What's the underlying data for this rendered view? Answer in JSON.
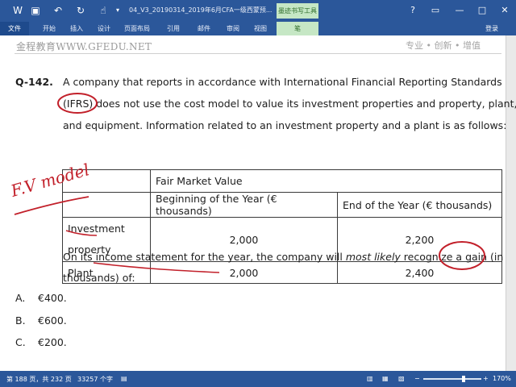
{
  "window": {
    "title": "04_V3_20190314_2019年6月CFA一级西蒙预...",
    "tool_tab": "墨迹书写工具",
    "login": "登录",
    "min_glyph": "—",
    "max_glyph": "□",
    "close_glyph": "✕",
    "help_glyph": "?"
  },
  "ribbon": {
    "tabs": [
      {
        "label": "文件"
      },
      {
        "label": "开始"
      },
      {
        "label": "插入"
      },
      {
        "label": "设计"
      },
      {
        "label": "页面布局"
      },
      {
        "label": "引用"
      },
      {
        "label": "邮件"
      },
      {
        "label": "审阅"
      },
      {
        "label": "视图"
      },
      {
        "label": "笔"
      }
    ]
  },
  "document": {
    "header_left": "金程教育WWW.GFEDU.NET",
    "header_right": "专业 • 创新 • 增值",
    "question_number": "Q-142.",
    "lines": [
      "A company that reports in accordance with International Financial Reporting Standards",
      "(IFRS) does not use the cost model to value its investment properties and property, plant,",
      "and equipment. Information related to an investment property and a plant is as follows:"
    ],
    "table": {
      "group_header": "Fair Market Value",
      "col_headers": [
        "Beginning of the Year (€ thousands)",
        "End of the Year (€ thousands)"
      ],
      "rows": [
        {
          "label_line1": "Investment",
          "label_line2": "property",
          "begin": "2,000",
          "end": "2,200"
        },
        {
          "label_line1": "Plant",
          "begin": "2,000",
          "end": "2,400"
        }
      ]
    },
    "prompt_line1_a": "On its income statement for the year, the company will ",
    "prompt_line1_em": "most likely",
    "prompt_line1_b": " recognize a gain (in",
    "prompt_line2": "thousands) of:",
    "options": [
      {
        "letter": "A.",
        "text": "€400."
      },
      {
        "letter": "B.",
        "text": "€600."
      },
      {
        "letter": "C.",
        "text": "€200."
      }
    ],
    "ink_note": "F.V model"
  },
  "status": {
    "page": "第 188 页，共 232 页",
    "words": "33257 个字",
    "zoom": "170%",
    "zoom_level": 0.7
  }
}
